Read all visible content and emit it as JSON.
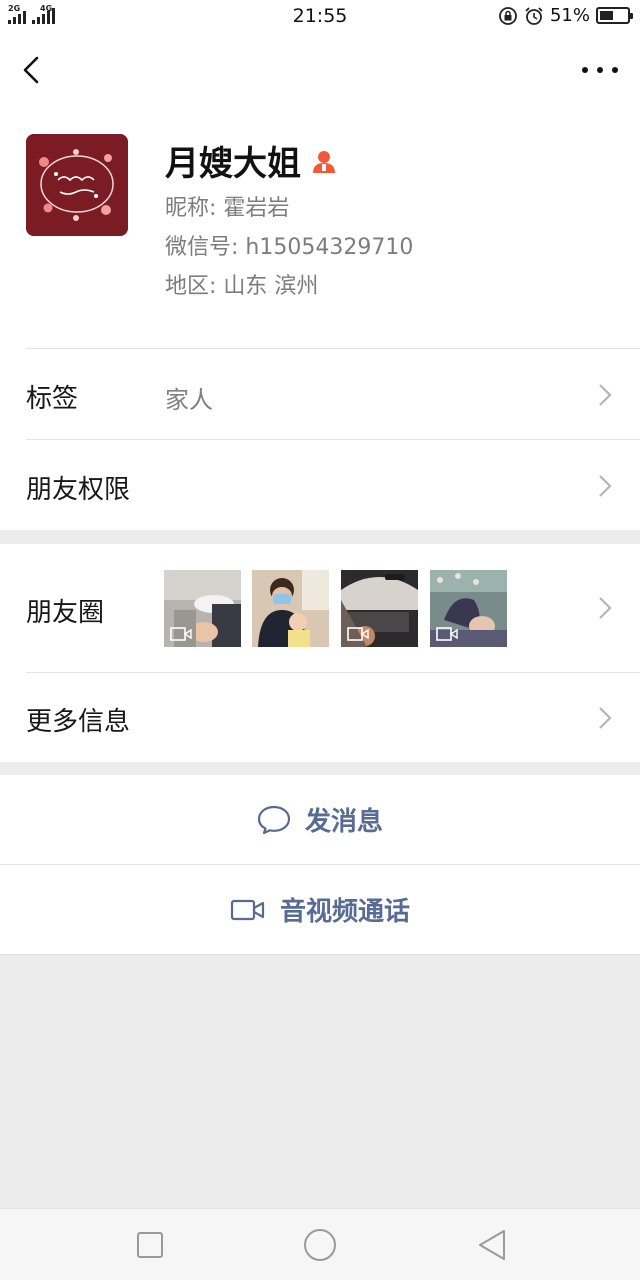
{
  "status_bar": {
    "sim1_label": "2G",
    "sim2_label": "4G",
    "time": "21:55",
    "battery_text": "51%",
    "battery_level": 0.51,
    "icons": [
      "signal-icon",
      "rotation-lock-icon",
      "alarm-icon",
      "battery-icon"
    ]
  },
  "topbar": {
    "back_icon": "chevron-left-icon",
    "more_icon": "more-dots-icon"
  },
  "profile": {
    "remark_name": "月嫂大姐",
    "badge_icon": "person-badge-icon",
    "nickname": "昵称:  霍岩岩",
    "wechat_id": "微信号:  h15054329710",
    "region": "地区:  山东  滨州"
  },
  "rows": {
    "tags_label": "标签",
    "tags_value": "家人",
    "permissions_label": "朋友权限",
    "moments_label": "朋友圈",
    "more_info_label": "更多信息"
  },
  "moments_thumbs": [
    {
      "name": "moment-thumb-1",
      "has_video": true
    },
    {
      "name": "moment-thumb-2",
      "has_video": false
    },
    {
      "name": "moment-thumb-3",
      "has_video": true
    },
    {
      "name": "moment-thumb-4",
      "has_video": true
    }
  ],
  "actions": {
    "send_message": "发消息",
    "video_call": "音视频通话",
    "send_message_icon": "chat-bubble-icon",
    "video_call_icon": "video-camera-icon"
  },
  "colors": {
    "link_blue": "#576b95",
    "badge_orange": "#f05a3a",
    "background": "#ececec"
  },
  "navbar": {
    "icons": [
      "recents-square-icon",
      "home-circle-icon",
      "back-triangle-icon"
    ]
  }
}
